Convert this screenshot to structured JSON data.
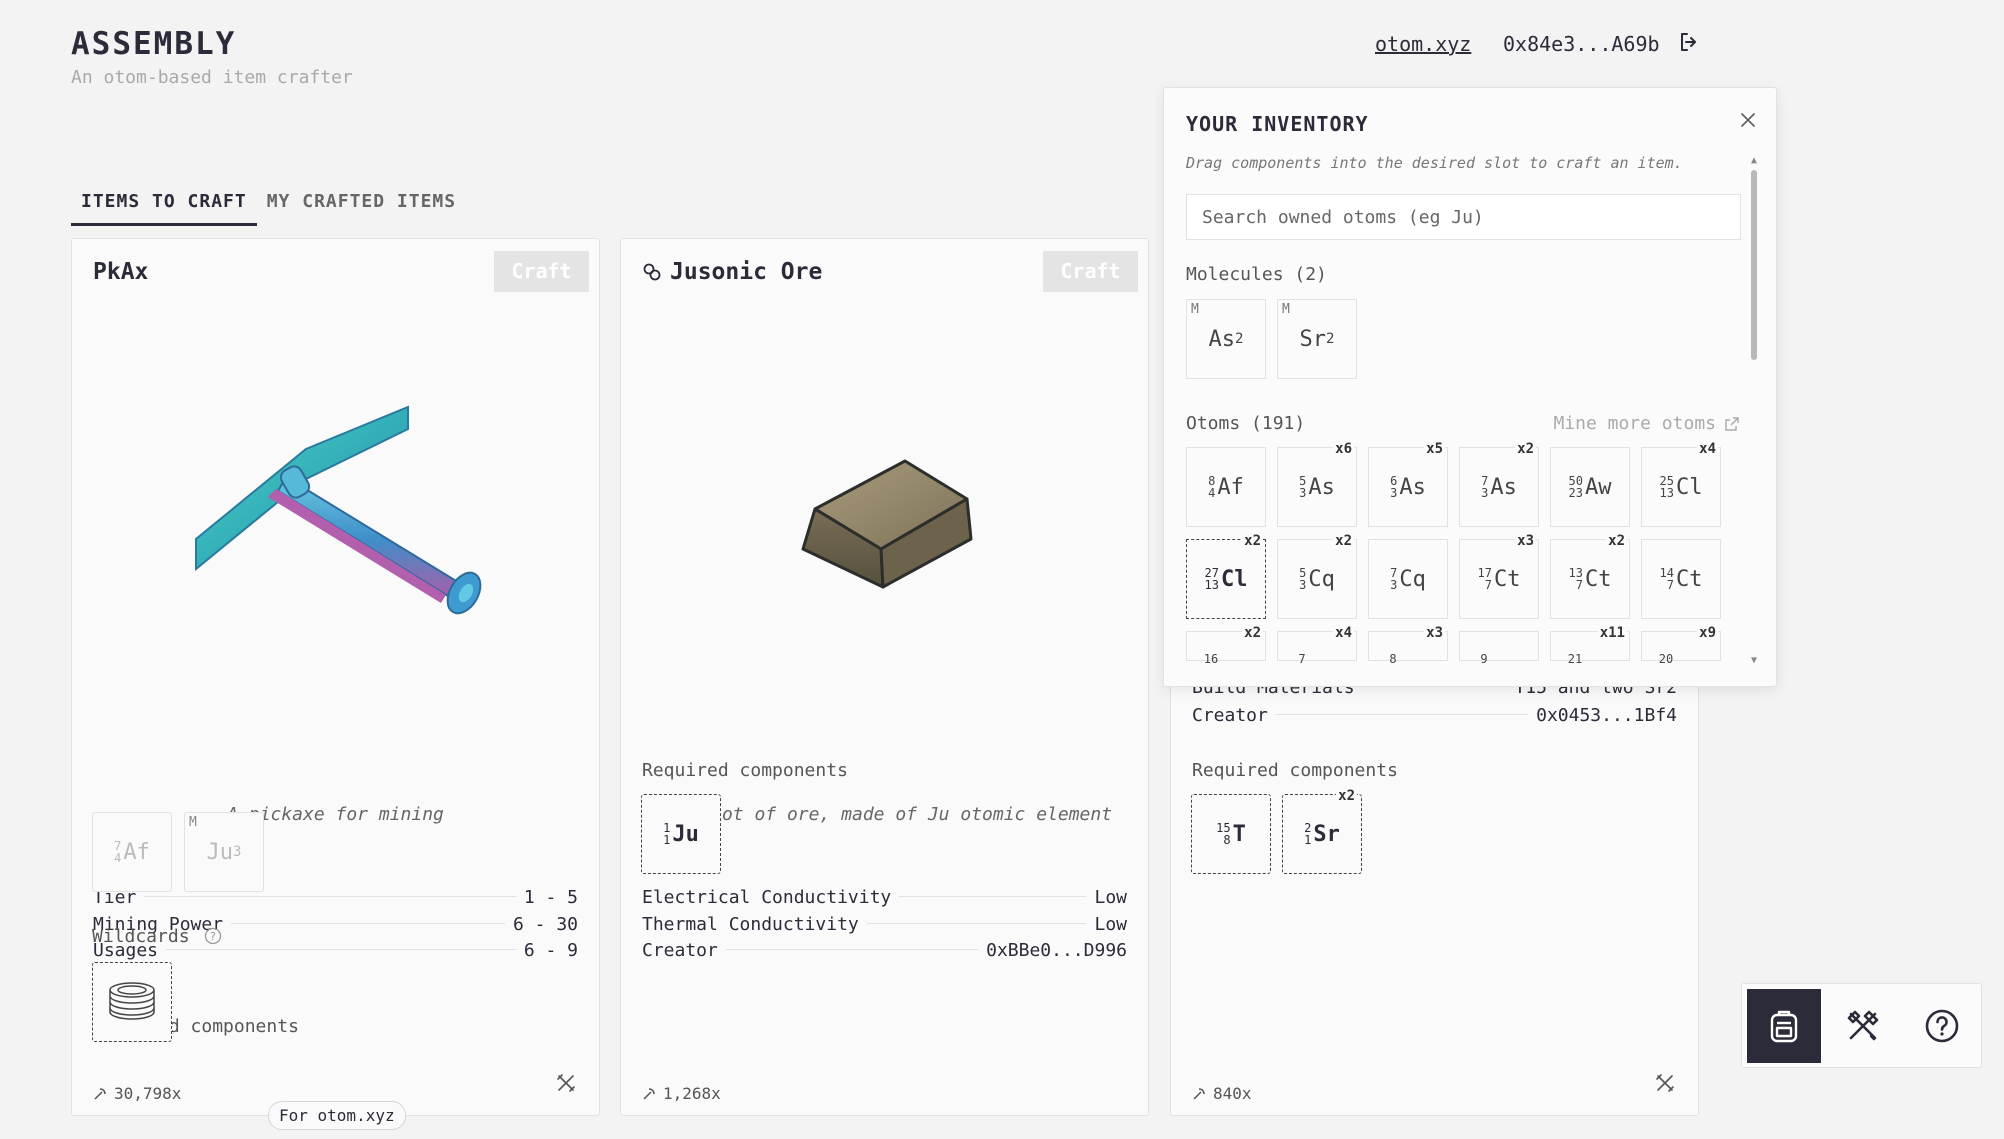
{
  "app": {
    "title": "ASSEMBLY",
    "subtitle": "An otom-based item crafter"
  },
  "header": {
    "link": "otom.xyz",
    "wallet": "0x84e3...A69b",
    "logout_icon": "logout-icon"
  },
  "tabs": [
    {
      "label": "ITEMS TO CRAFT",
      "active": true
    },
    {
      "label": "MY CRAFTED ITEMS",
      "active": false
    }
  ],
  "cards": [
    {
      "title": "PkAx",
      "craft_label": "Craft",
      "description": "A pickaxe for mining",
      "stats": [
        {
          "label": "Tier",
          "value": "1 - 5"
        },
        {
          "label": "Mining Power",
          "value": "6 - 30"
        },
        {
          "label": "Usages",
          "value": "6 - 9"
        }
      ],
      "required_label": "Required components",
      "required": [
        {
          "sym": "Af",
          "mass": "7",
          "z": "4"
        },
        {
          "tag": "M",
          "sym": "Ju",
          "sub": "3"
        }
      ],
      "wildcards_label": "Wildcards",
      "usage": "30,798x"
    },
    {
      "title": "Jusonic Ore",
      "craft_label": "Craft",
      "description": "An ingot of ore, made of Ju otomic element",
      "stats": [
        {
          "label": "Electrical Conductivity",
          "value": "Low"
        },
        {
          "label": "Thermal Conductivity",
          "value": "Low"
        },
        {
          "label": "Creator",
          "value": "0xBBe0...D996"
        }
      ],
      "required_label": "Required components",
      "required": [
        {
          "sym": "Ju",
          "mass": "1",
          "z": "1"
        }
      ],
      "usage": "1,268x"
    },
    {
      "stats_partial": [
        {
          "label": "Build Materials",
          "value": "T15 and two Sr2"
        },
        {
          "label": "Creator",
          "value": "0x0453...1Bf4"
        }
      ],
      "required_label": "Required components",
      "required": [
        {
          "sym": "T",
          "mass": "15",
          "z": "8"
        },
        {
          "sym": "Sr",
          "mass": "2",
          "z": "1",
          "count": "x2"
        }
      ],
      "usage": "840x"
    }
  ],
  "tooltip": "For otom.xyz",
  "inventory": {
    "title": "YOUR INVENTORY",
    "hint": "Drag components into the desired slot to craft an item.",
    "search_placeholder": "Search owned otoms (eg Ju)",
    "molecules_label": "Molecules (2)",
    "molecules": [
      {
        "tag": "M",
        "sym": "As",
        "sub": "2"
      },
      {
        "tag": "M",
        "sym": "Sr",
        "sub": "2"
      }
    ],
    "otoms_label": "Otoms (191)",
    "mine_label": "Mine more otoms",
    "otoms": [
      {
        "sym": "Af",
        "mass": "8",
        "z": "4",
        "count": ""
      },
      {
        "sym": "As",
        "mass": "5",
        "z": "3",
        "count": "x6"
      },
      {
        "sym": "As",
        "mass": "6",
        "z": "3",
        "count": "x5"
      },
      {
        "sym": "As",
        "mass": "7",
        "z": "3",
        "count": "x2"
      },
      {
        "sym": "Aw",
        "mass": "50",
        "z": "23",
        "count": ""
      },
      {
        "sym": "Cl",
        "mass": "25",
        "z": "13",
        "count": "x4"
      },
      {
        "sym": "Cl",
        "mass": "27",
        "z": "13",
        "count": "x2",
        "selected": true
      },
      {
        "sym": "Cq",
        "mass": "5",
        "z": "3",
        "count": "x2"
      },
      {
        "sym": "Cq",
        "mass": "7",
        "z": "3",
        "count": ""
      },
      {
        "sym": "Ct",
        "mass": "17",
        "z": "7",
        "count": "x3"
      },
      {
        "sym": "Ct",
        "mass": "13",
        "z": "7",
        "count": "x2"
      },
      {
        "sym": "Ct",
        "mass": "14",
        "z": "7",
        "count": ""
      }
    ],
    "otoms_partial": [
      {
        "mass": "16",
        "count": "x2"
      },
      {
        "mass": "7",
        "count": "x4"
      },
      {
        "mass": "8",
        "count": "x3"
      },
      {
        "mass": "9",
        "count": ""
      },
      {
        "mass": "21",
        "count": "x11"
      },
      {
        "mass": "20",
        "count": "x9"
      }
    ]
  },
  "dock": [
    {
      "icon": "backpack-icon",
      "active": true
    },
    {
      "icon": "tools-icon",
      "active": false
    },
    {
      "icon": "help-icon",
      "active": false
    }
  ]
}
